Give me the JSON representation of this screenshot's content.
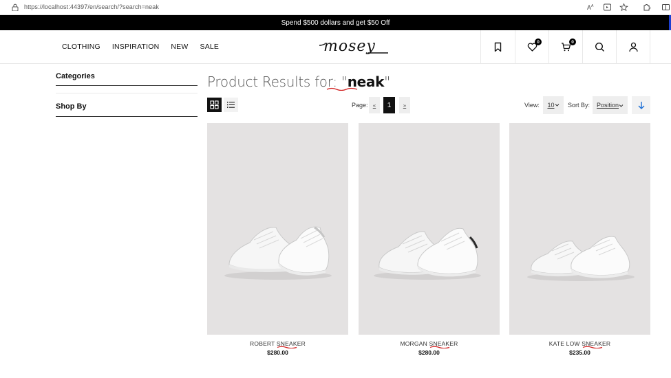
{
  "browser": {
    "url": "https://localhost:44397/en/search/?search=neak",
    "icons": [
      "lock-icon",
      "read-aloud-icon",
      "app-available-icon",
      "favorite-star-icon",
      "extensions-icon",
      "split-screen-icon"
    ]
  },
  "promo": {
    "text": "Spend $500 dollars and get $50 Off"
  },
  "header": {
    "nav": [
      "CLOTHING",
      "INSPIRATION",
      "NEW",
      "SALE"
    ],
    "logo_text": "mosey",
    "wishlist_count": "0",
    "cart_count": "0",
    "icons": [
      "bookmark-icon",
      "heart-icon",
      "cart-icon",
      "search-icon",
      "account-icon"
    ]
  },
  "sidebar": {
    "categories_title": "Categories",
    "shopby_title": "Shop By"
  },
  "results": {
    "title_prefix": "Product Results for: \"",
    "term": "neak",
    "title_suffix": "\""
  },
  "toolbar": {
    "page_label": "Page:",
    "prev": "«",
    "current_page": "1",
    "next": "»",
    "view_label": "View:",
    "view_value": "10",
    "sort_label": "Sort By:",
    "sort_value": "Position"
  },
  "products": [
    {
      "name": "ROBERT SNEAKER",
      "price": "$280.00"
    },
    {
      "name": "MORGAN SNEAKER",
      "price": "$280.00"
    },
    {
      "name": "KATE LOW SNEAKER",
      "price": "$235.00"
    }
  ],
  "colors": {
    "promo_bg": "#000000",
    "image_bg": "#e4e2e2",
    "accent_blue": "#1d6fd6",
    "spell_underline": "#d11f1f"
  }
}
